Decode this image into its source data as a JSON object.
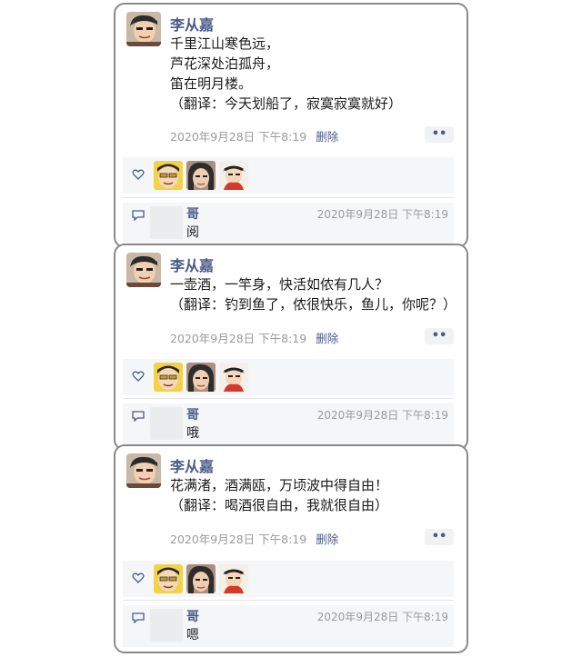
{
  "posts": [
    {
      "author": "李从嘉",
      "lines": [
        "千里江山寒色远，",
        "芦花深处泊孤舟，",
        "笛在明月楼。",
        "（翻译：今天划船了，寂寞寂寞就好）"
      ],
      "time": "2020年9月28日 下午8:19",
      "delete_label": "删除",
      "more_label": "••",
      "comment": {
        "name": "哥",
        "time": "2020年9月28日 下午8:19",
        "text": "阅"
      }
    },
    {
      "author": "李从嘉",
      "lines": [
        "一壶酒，一竿身，快活如侬有几人？",
        "（翻译：钓到鱼了，侬很快乐，鱼儿，你呢？）"
      ],
      "time": "2020年9月28日 下午8:19",
      "delete_label": "删除",
      "more_label": "••",
      "comment": {
        "name": "哥",
        "time": "2020年9月28日 下午8:19",
        "text": "哦"
      }
    },
    {
      "author": "李从嘉",
      "lines": [
        "花满渚，酒满瓯，万顷波中得自由！",
        "（翻译：喝酒很自由，我就很自由）"
      ],
      "time": "2020年9月28日 下午8:19",
      "delete_label": "删除",
      "more_label": "••",
      "comment": {
        "name": "哥",
        "time": "2020年9月28日 下午8:19",
        "text": "嗯"
      }
    }
  ],
  "colors": {
    "name_blue": "#4a5b8a",
    "meta_gray": "#9a9a9a",
    "panel_bg": "#f5f6f8",
    "border": "#8a8a8a"
  }
}
